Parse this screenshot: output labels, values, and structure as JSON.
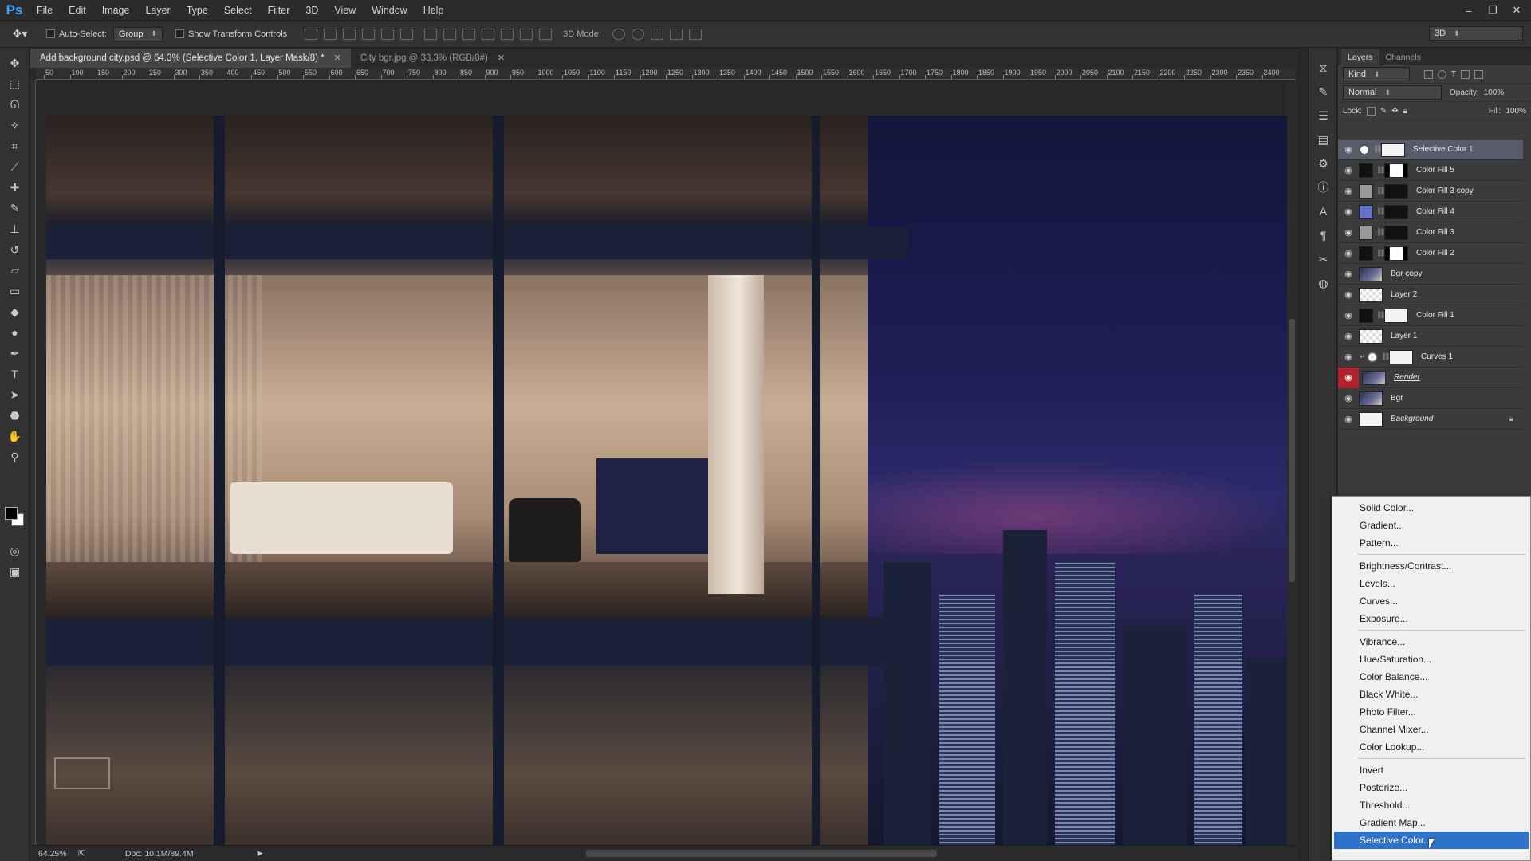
{
  "app": {
    "logo": "Ps"
  },
  "menu": [
    "File",
    "Edit",
    "Image",
    "Layer",
    "Type",
    "Select",
    "Filter",
    "3D",
    "View",
    "Window",
    "Help"
  ],
  "options": {
    "auto_select_label": "Auto-Select:",
    "auto_select_value": "Group",
    "transform_label": "Show Transform Controls",
    "mode_3d_label": "3D Mode:",
    "workspace_value": "3D"
  },
  "tabs": [
    {
      "label": "Add background city.psd @ 64.3% (Selective Color 1, Layer Mask/8) *",
      "active": true
    },
    {
      "label": "City bgr.jpg @ 33.3% (RGB/8#)",
      "active": false
    }
  ],
  "ruler_ticks": [
    "50",
    "100",
    "150",
    "200",
    "250",
    "300",
    "350",
    "400",
    "450",
    "500",
    "550",
    "600",
    "650",
    "700",
    "750",
    "800",
    "850",
    "900",
    "950",
    "1000",
    "1050",
    "1100",
    "1150",
    "1200",
    "1250",
    "1300",
    "1350",
    "1400",
    "1450",
    "1500",
    "1550",
    "1600",
    "1650",
    "1700",
    "1750",
    "1800",
    "1850",
    "1900",
    "1950",
    "2000",
    "2050",
    "2100",
    "2150",
    "2200",
    "2250",
    "2300",
    "2350",
    "2400"
  ],
  "status": {
    "zoom": "64.25%",
    "doc": "Doc: 10.1M/89.4M"
  },
  "layers_panel": {
    "tabs": [
      "Layers",
      "Channels"
    ],
    "filter_kind": "Kind",
    "blend_mode": "Normal",
    "opacity_label": "Opacity:",
    "opacity_value": "100%",
    "lock_label": "Lock:",
    "fill_label": "Fill:",
    "fill_value": "100%",
    "layers": [
      {
        "name": "Selective Color 1",
        "selected": true
      },
      {
        "name": "Color Fill 5"
      },
      {
        "name": "Color Fill 3 copy"
      },
      {
        "name": "Color Fill 4"
      },
      {
        "name": "Color Fill 3"
      },
      {
        "name": "Color Fill 2"
      },
      {
        "name": "Bgr copy"
      },
      {
        "name": "Layer 2"
      },
      {
        "name": "Color Fill 1"
      },
      {
        "name": "Layer 1"
      },
      {
        "name": "Curves 1"
      },
      {
        "name": "Render"
      },
      {
        "name": "Bgr"
      },
      {
        "name": "Background"
      }
    ]
  },
  "adjustment_menu": {
    "items": [
      "Solid Color...",
      "Gradient...",
      "Pattern...",
      "Brightness/Contrast...",
      "Levels...",
      "Curves...",
      "Exposure...",
      "Vibrance...",
      "Hue/Saturation...",
      "Color Balance...",
      "Black  White...",
      "Photo Filter...",
      "Channel Mixer...",
      "Color Lookup...",
      "Invert",
      "Posterize...",
      "Threshold...",
      "Gradient Map...",
      "Selective Color..."
    ],
    "highlighted": "Selective Color..."
  }
}
